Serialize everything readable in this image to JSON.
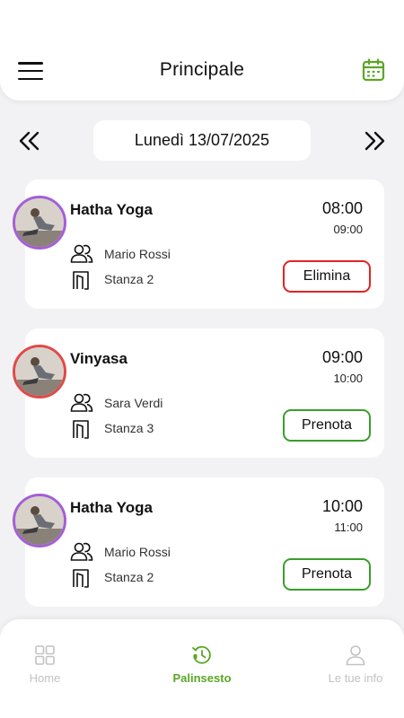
{
  "header": {
    "title": "Principale",
    "menu_icon": "hamburger-menu-icon",
    "calendar_icon": "calendar-icon",
    "accent": "#5aa625"
  },
  "date_nav": {
    "date_label": "Lunedì 13/07/2025",
    "prev_icon": "double-chevron-left-icon",
    "next_icon": "double-chevron-right-icon"
  },
  "classes": [
    {
      "name": "Hatha Yoga",
      "start": "08:00",
      "end": "09:00",
      "instructor": "Mario Rossi",
      "room": "Stanza 2",
      "action": "Elimina",
      "action_color": "#e02424",
      "avatar_border": "#a45fd6"
    },
    {
      "name": "Vinyasa",
      "start": "09:00",
      "end": "10:00",
      "instructor": "Sara Verdi",
      "room": "Stanza 3",
      "action": "Prenota",
      "action_color": "#3a9e2b",
      "avatar_border": "#e04a4a"
    },
    {
      "name": "Hatha Yoga",
      "start": "10:00",
      "end": "11:00",
      "instructor": "Mario Rossi",
      "room": "Stanza 2",
      "action": "Prenota",
      "action_color": "#3a9e2b",
      "avatar_border": "#a45fd6"
    }
  ],
  "bottom_nav": {
    "tabs": [
      {
        "label": "Home",
        "icon": "grid-icon",
        "active": false
      },
      {
        "label": "Palinsesto",
        "icon": "clock-schedule-icon",
        "active": true
      },
      {
        "label": "Le tue info",
        "icon": "user-icon",
        "active": false
      }
    ]
  }
}
